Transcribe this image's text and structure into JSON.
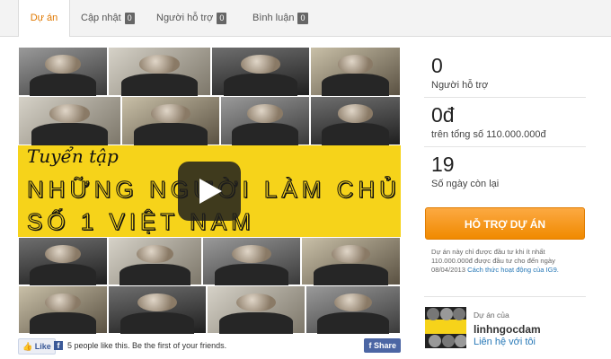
{
  "tabs": [
    {
      "label": "Dự án",
      "count": ""
    },
    {
      "label": "Cập nhật",
      "count": "0"
    },
    {
      "label": "Người hỗ trợ",
      "count": "0"
    },
    {
      "label": "Bình luận",
      "count": "0"
    }
  ],
  "video": {
    "banner_title": "Tuyển tập",
    "banner_line1": "NHỮNG NGƯỜI LÀM CHỦ",
    "banner_line2": "SỐ 1 VIỆT NAM"
  },
  "social": {
    "like_label": "Like",
    "fb_glyph": "f",
    "like_text": "5 people like this. Be the first of your friends.",
    "share_label": "Share"
  },
  "stats": {
    "supporters_value": "0",
    "supporters_label": "Người hỗ trợ",
    "amount_value": "0đ",
    "amount_label": "trên tổng số 110.000.000đ",
    "days_value": "19",
    "days_label": "Số ngày còn lại"
  },
  "support_button": "HỖ TRỢ DỰ ÁN",
  "notice": {
    "text": "Dự án này chỉ được đầu tư khi ít nhất 110.000.000đ được đầu tư cho đến ngày 08/04/2013",
    "link": "Cách thức hoạt động của IG9."
  },
  "owner": {
    "caption": "Dự án của",
    "name": "linhngocdam",
    "contact": "Liên hệ với tôi"
  },
  "colors": {
    "accent": "#f08a00",
    "banner_yellow": "#f6d31a",
    "link": "#2a7ab8",
    "facebook": "#3b5998"
  }
}
